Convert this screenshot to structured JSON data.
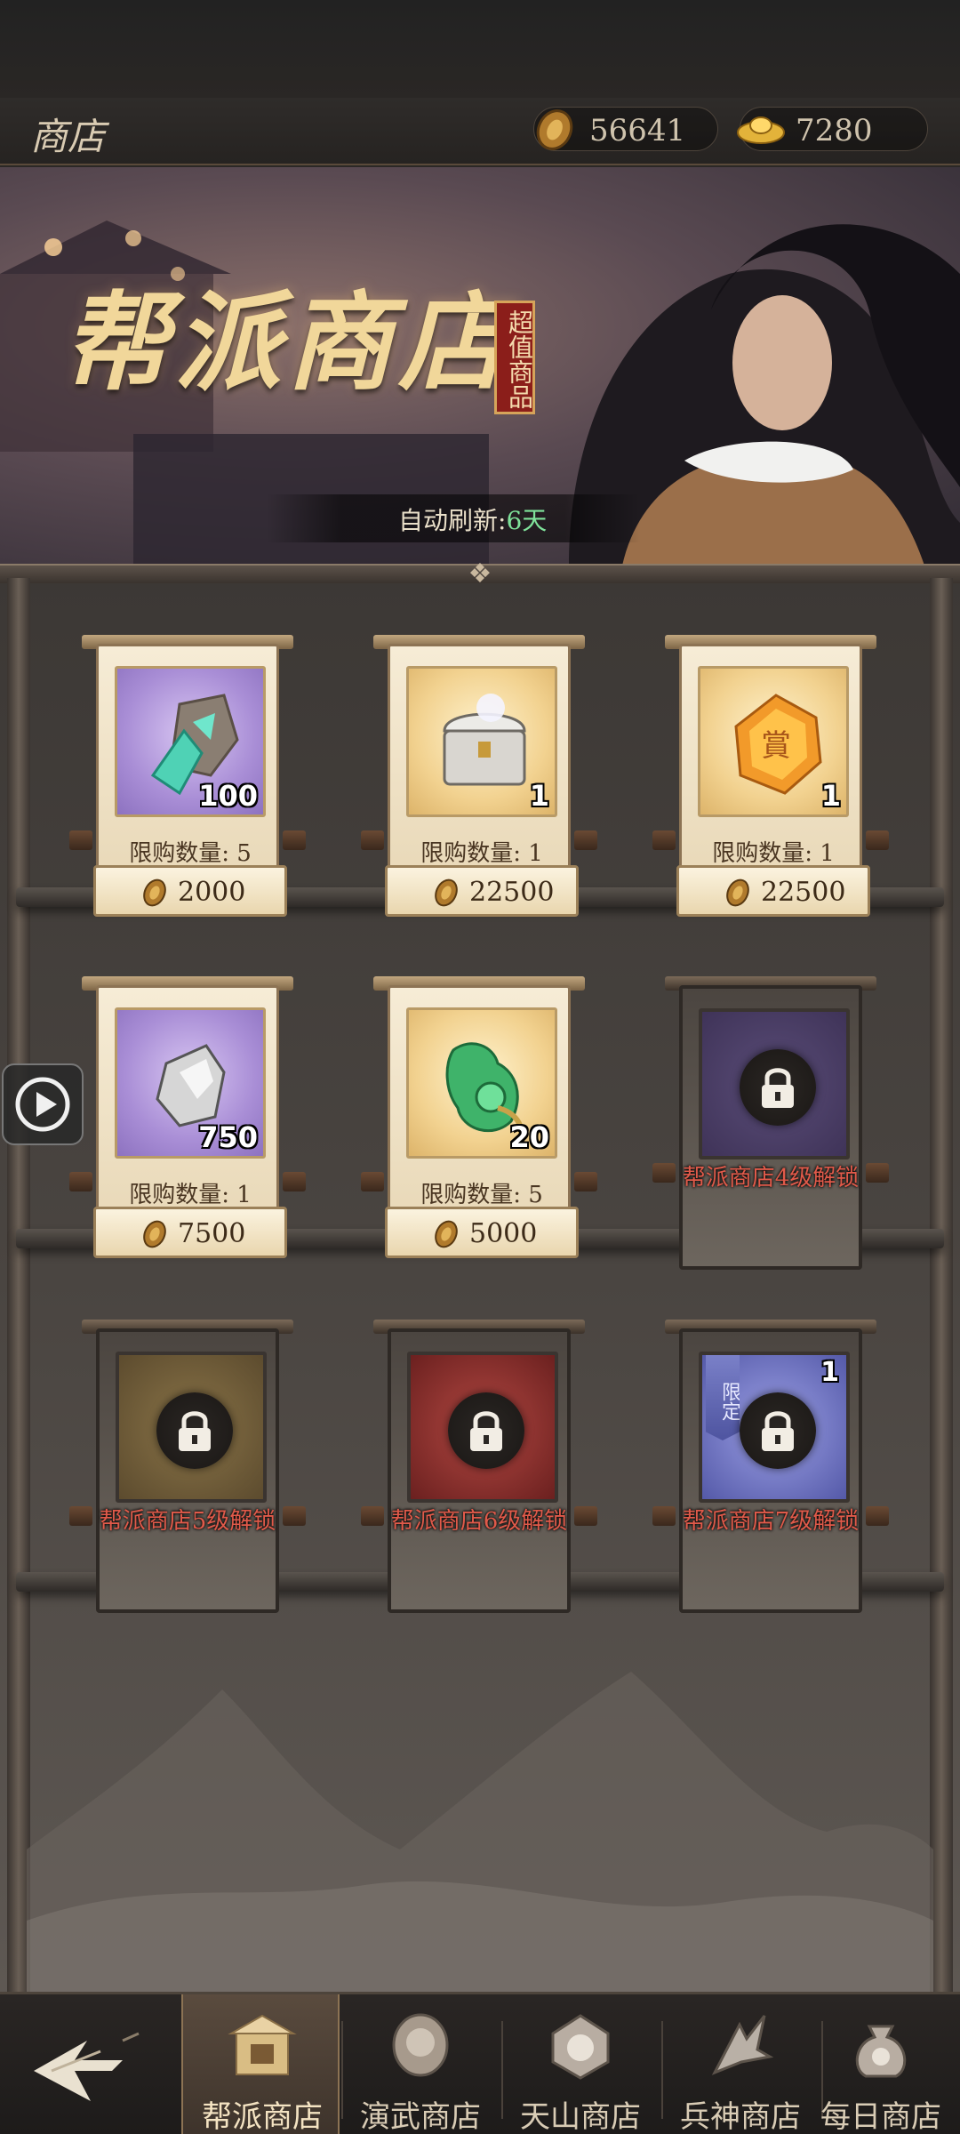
{
  "header": {
    "title": "商店",
    "currency_coins": "56641",
    "currency_gold": "7280"
  },
  "banner": {
    "title": "帮派商店",
    "badge": "超值商品",
    "refresh_label": "自动刷新:",
    "refresh_value": "6天"
  },
  "items": [
    {
      "qty": "100",
      "limit": "限购数量: 5",
      "price": "2000",
      "icon": "crystal-ore-icon"
    },
    {
      "qty": "1",
      "limit": "限购数量: 1",
      "price": "22500",
      "icon": "silver-chest-icon"
    },
    {
      "qty": "1",
      "limit": "限购数量: 1",
      "price": "22500",
      "icon": "gold-token-icon"
    },
    {
      "qty": "750",
      "limit": "限购数量: 1",
      "price": "7500",
      "icon": "iron-ore-icon"
    },
    {
      "qty": "20",
      "limit": "限购数量: 5",
      "price": "5000",
      "icon": "jade-ornament-icon"
    }
  ],
  "locked": [
    {
      "text": "帮派商店4级解锁"
    },
    {
      "text": "帮派商店5级解锁"
    },
    {
      "text": "帮派商店6级解锁"
    },
    {
      "text": "帮派商店7级解锁",
      "tag": "限定",
      "qty": "1"
    }
  ],
  "nav": {
    "tabs": [
      {
        "label": "帮派商店",
        "icon": "gang-shop-icon",
        "active": true
      },
      {
        "label": "演武商店",
        "icon": "martial-shop-icon"
      },
      {
        "label": "天山商店",
        "icon": "tianshan-shop-icon"
      },
      {
        "label": "兵神商店",
        "icon": "weapon-shop-icon"
      },
      {
        "label": "每日商店",
        "icon": "daily-shop-icon"
      }
    ]
  },
  "colors": {
    "accent_gold": "#f1d79a",
    "lock_text": "#e05a4a",
    "refresh_value": "#7fe29a"
  }
}
